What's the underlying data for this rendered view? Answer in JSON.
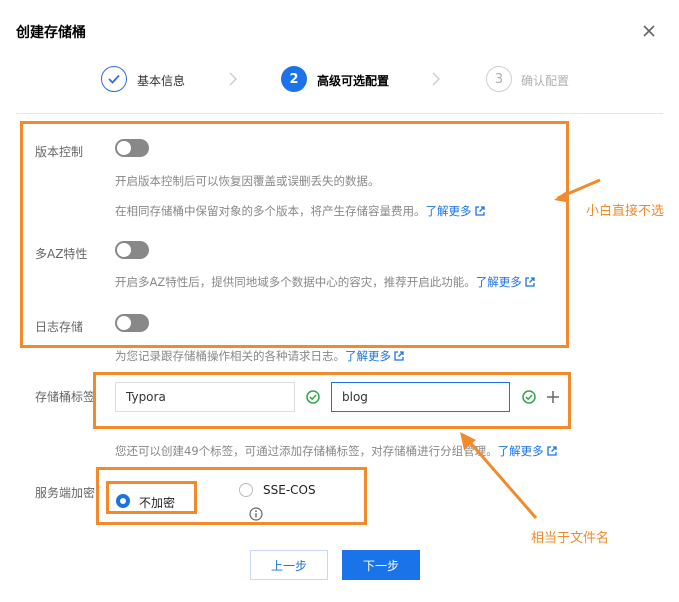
{
  "dialog": {
    "title": "创建存储桶"
  },
  "steps": [
    {
      "num": "",
      "label": "基本信息",
      "state": "done"
    },
    {
      "num": "2",
      "label": "高级可选配置",
      "state": "active"
    },
    {
      "num": "3",
      "label": "确认配置",
      "state": "pending"
    }
  ],
  "versioning": {
    "label": "版本控制",
    "desc1": "开启版本控制后可以恢复因覆盖或误删丢失的数据。",
    "desc2": "在相同存储桶中保留对象的多个版本，将产生存储容量费用。",
    "link": "了解更多",
    "enabled": false
  },
  "multi_az": {
    "label": "多AZ特性",
    "desc": "开启多AZ特性后，提供同地域多个数据中心的容灾，推荐开启此功能。",
    "link": "了解更多",
    "enabled": false
  },
  "logging": {
    "label": "日志存储",
    "desc": "为您记录跟存储桶操作相关的各种请求日志。",
    "link": "了解更多",
    "enabled": false
  },
  "tags": {
    "label": "存储桶标签",
    "key": "Typora",
    "value": "blog",
    "hint": "您还可以创建49个标签，可通过添加存储桶标签，对存储桶进行分组管理。",
    "link": "了解更多"
  },
  "encryption": {
    "label": "服务端加密",
    "options": [
      {
        "label": "不加密",
        "selected": true
      },
      {
        "label": "SSE-COS",
        "selected": false
      }
    ]
  },
  "annotations": {
    "top": "小白直接不选",
    "bottom": "相当于文件名"
  },
  "buttons": {
    "prev": "上一步",
    "next": "下一步"
  },
  "colors": {
    "primary": "#1a73e8",
    "annotation": "#f08a2c",
    "toggle_off": "#888888",
    "success": "#2fa54a"
  }
}
